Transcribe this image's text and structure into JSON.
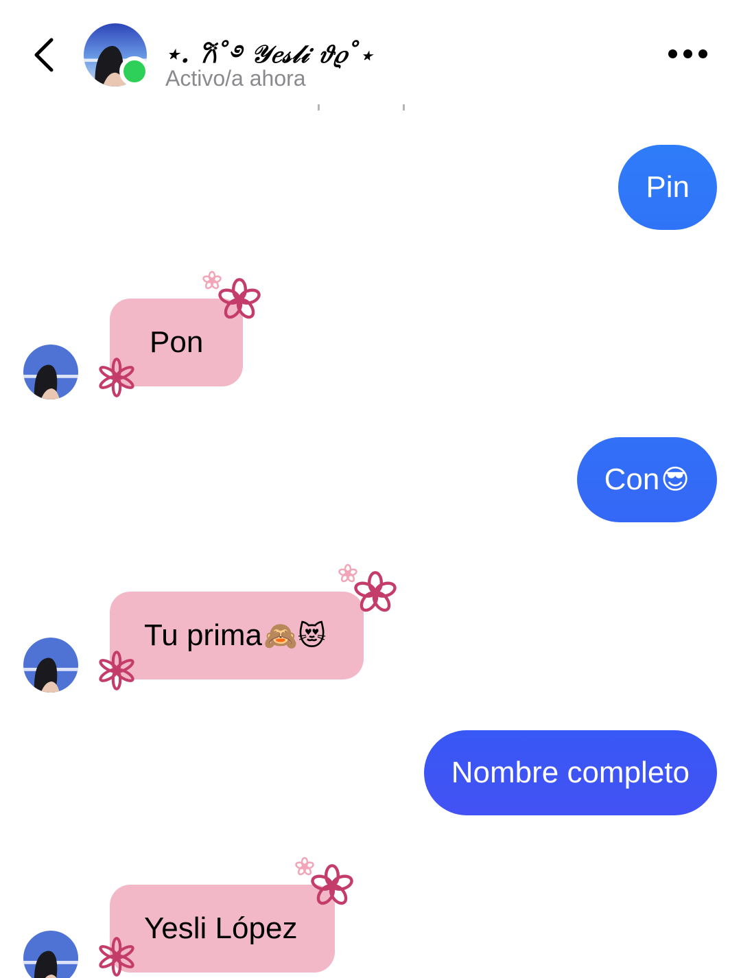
{
  "header": {
    "contact_name": "⋆. 𐙚˚࿔ 𝒴𝑒𝓈𝓁𝒾 𝜗𝜚˚⋆",
    "status": "Activo/a ahora",
    "icons": {
      "back": "chevron-left-icon",
      "more": "more-horizontal-icon",
      "online": "online-status-dot"
    }
  },
  "messages": [
    {
      "id": "m1",
      "direction": "outgoing",
      "text": "Pin",
      "emoji": ""
    },
    {
      "id": "m2",
      "direction": "incoming",
      "text": "Pon",
      "emoji": ""
    },
    {
      "id": "m3",
      "direction": "outgoing",
      "text": "Con",
      "emoji": "😎"
    },
    {
      "id": "m4",
      "direction": "incoming",
      "text": "Tu prima ",
      "emoji": "🙈😻"
    },
    {
      "id": "m5",
      "direction": "outgoing",
      "text": "Nombre completo",
      "emoji": ""
    },
    {
      "id": "m6",
      "direction": "incoming",
      "text": "Yesli López",
      "emoji": ""
    }
  ],
  "colors": {
    "outgoing_gradient_top": "#2f7cf8",
    "outgoing_gradient_bottom": "#4253f4",
    "incoming_bubble": "#f3b8c7",
    "flower_stroke": "#c43d6a",
    "flower_small_stroke": "#f2a4b8",
    "online_dot": "#2fd05a",
    "status_text": "#8a8a8e"
  }
}
